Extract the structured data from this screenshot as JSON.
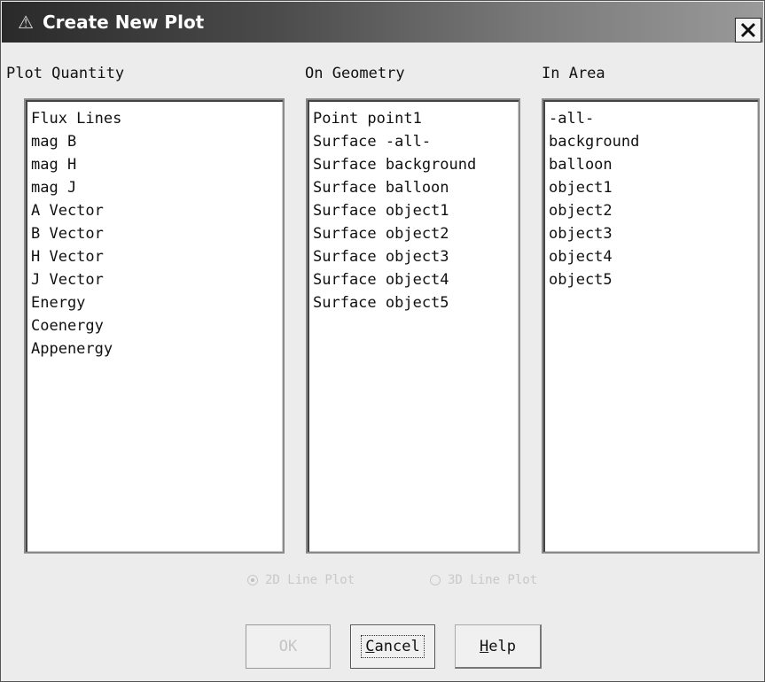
{
  "window": {
    "title": "Create New Plot",
    "close_label": "X"
  },
  "columns": {
    "plot_quantity": {
      "label": "Plot Quantity",
      "items": [
        "Flux Lines",
        "mag B",
        "mag H",
        "mag J",
        "A Vector",
        "B Vector",
        "H Vector",
        "J Vector",
        "Energy",
        "Coenergy",
        "Appenergy"
      ]
    },
    "on_geometry": {
      "label": "On Geometry",
      "items": [
        "Point point1",
        "Surface -all-",
        "Surface background",
        "Surface balloon",
        "Surface object1",
        "Surface object2",
        "Surface object3",
        "Surface object4",
        "Surface object5"
      ]
    },
    "in_area": {
      "label": "In Area",
      "items": [
        "-all-",
        "background",
        "balloon",
        "object1",
        "object2",
        "object3",
        "object4",
        "object5"
      ]
    }
  },
  "plot_type": {
    "option_2d": "2D Line Plot",
    "option_3d": "3D Line Plot",
    "selected": "2D Line Plot",
    "enabled": false
  },
  "buttons": {
    "ok": "OK",
    "cancel_prefix": "",
    "cancel_mnemonic": "C",
    "cancel_rest": "ancel",
    "help_mnemonic": "H",
    "help_rest": "elp"
  }
}
